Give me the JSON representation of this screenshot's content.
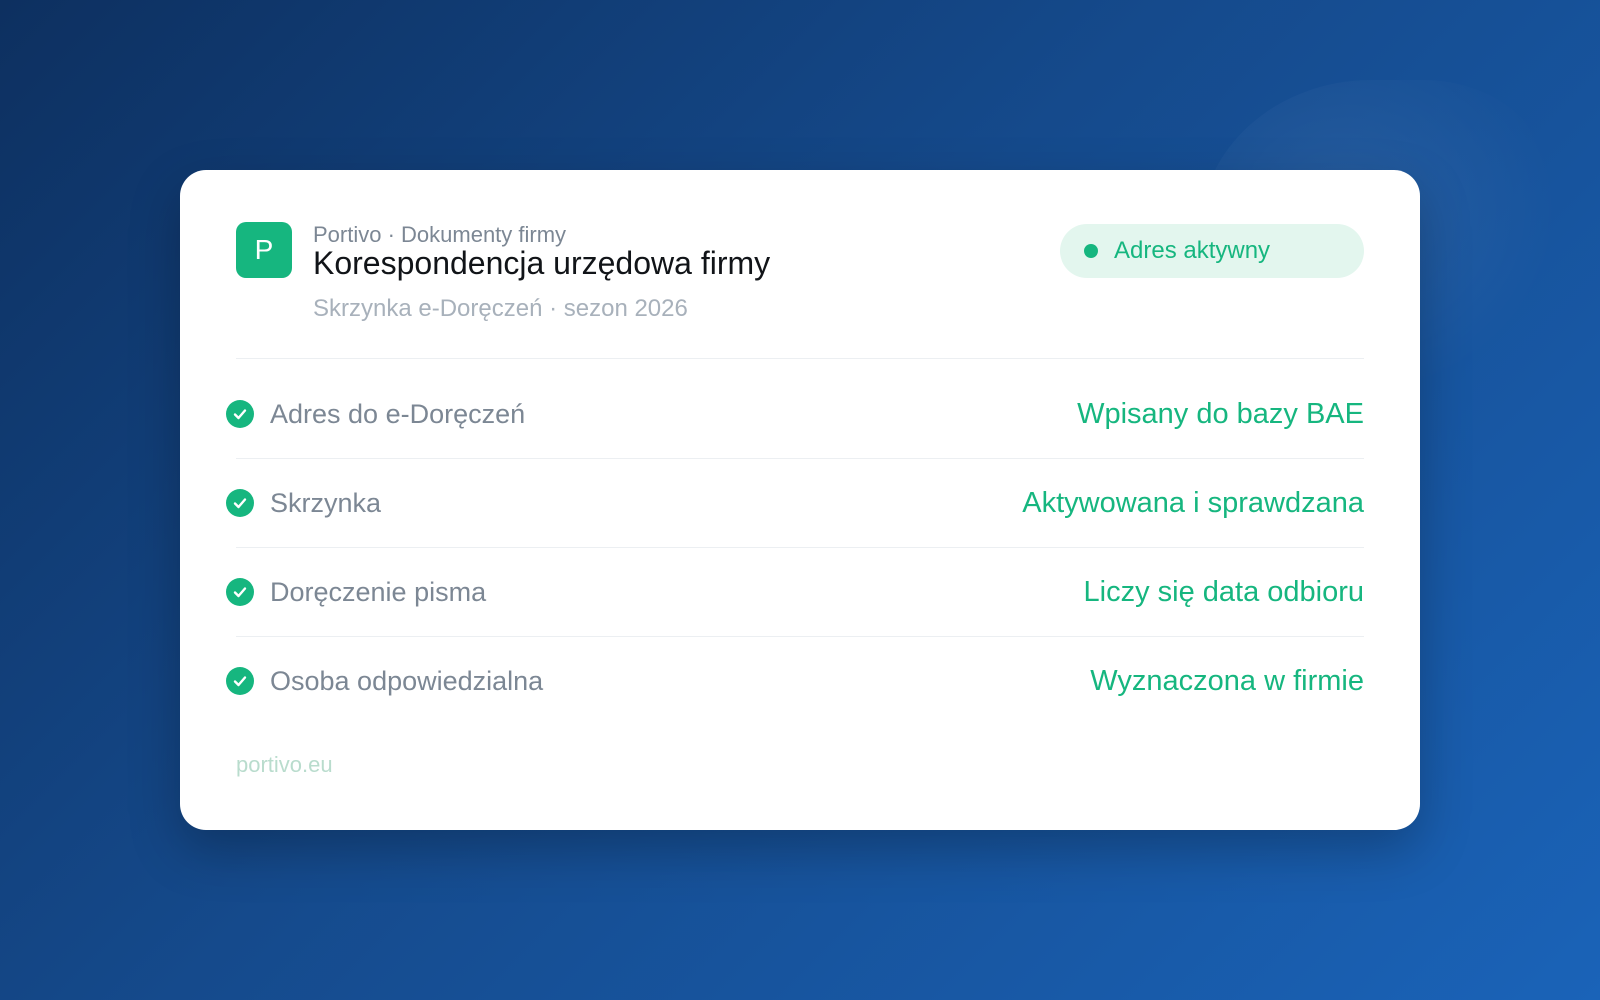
{
  "header": {
    "logo_letter": "P",
    "breadcrumb": "Portivo · Dokumenty firmy",
    "title": "Korespondencja urzędowa firmy",
    "subtitle": "Skrzynka e-Doręczeń · sezon 2026"
  },
  "status_badge": {
    "label": "Adres aktywny",
    "color": "#16b67f"
  },
  "rows": [
    {
      "label": "Adres do e-Doręczeń",
      "value": "Wpisany do bazy BAE",
      "icon": "check-circle-icon"
    },
    {
      "label": "Skrzynka",
      "value": "Aktywowana i sprawdzana",
      "icon": "check-circle-icon"
    },
    {
      "label": "Doręczenie pisma",
      "value": "Liczy się data odbioru",
      "icon": "check-circle-icon"
    },
    {
      "label": "Osoba odpowiedzialna",
      "value": "Wyznaczona w firmie",
      "icon": "check-circle-icon"
    }
  ],
  "footer": {
    "domain": "portivo.eu"
  },
  "colors": {
    "accent": "#16b67f",
    "badge_bg": "#e3f6ee"
  }
}
